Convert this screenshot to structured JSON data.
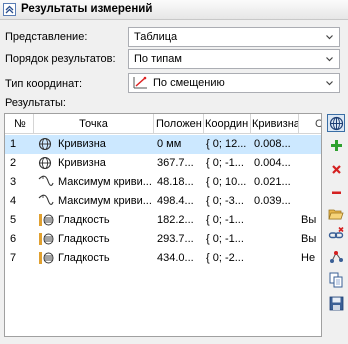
{
  "panel": {
    "title": "Результаты измерений"
  },
  "form": {
    "representation_label": "Представление:",
    "representation_value": "Таблица",
    "order_label": "Порядок результатов:",
    "order_value": "По типам",
    "coord_type_label": "Тип координат:",
    "coord_type_value": "По смещению",
    "results_label": "Результаты:"
  },
  "table": {
    "columns": [
      "№",
      "Точка",
      "Положен",
      "Координ",
      "Кривизна",
      "С"
    ],
    "rows": [
      {
        "num": "1",
        "icon": "curvature-icon",
        "point": "Кривизна",
        "pos": "0 мм",
        "coord": "{ 0; 12...",
        "curv": "0.008...",
        "extra": "",
        "selected": true
      },
      {
        "num": "2",
        "icon": "curvature-icon",
        "point": "Кривизна",
        "pos": "367.7...",
        "coord": "{ 0; -1...",
        "curv": "0.004...",
        "extra": "",
        "selected": false
      },
      {
        "num": "3",
        "icon": "curvature-max-icon",
        "point": "Максимум криви...",
        "pos": "48.18...",
        "coord": "{ 0; 10...",
        "curv": "0.021...",
        "extra": "",
        "selected": false
      },
      {
        "num": "4",
        "icon": "curvature-max-icon",
        "point": "Максимум криви...",
        "pos": "498.4...",
        "coord": "{ 0; -3...",
        "curv": "0.039...",
        "extra": "",
        "selected": false
      },
      {
        "num": "5",
        "icon": "smoothness-icon",
        "point": "Гладкость",
        "pos": "182.2...",
        "coord": "{ 0; -1...",
        "curv": "",
        "extra": "Вы",
        "selected": false
      },
      {
        "num": "6",
        "icon": "smoothness-icon",
        "point": "Гладкость",
        "pos": "293.7...",
        "coord": "{ 0; -1...",
        "curv": "",
        "extra": "Вы",
        "selected": false
      },
      {
        "num": "7",
        "icon": "smoothness-icon",
        "point": "Гладкость",
        "pos": "434.0...",
        "coord": "{ 0; -2...",
        "curv": "",
        "extra": "Не",
        "selected": false
      }
    ]
  },
  "toolbar": [
    "measure-icon",
    "add-icon",
    "delete-icon",
    "remove-icon",
    "open-folder-icon",
    "unlink-icon",
    "points-icon",
    "copy-icon",
    "save-icon"
  ],
  "colors": {
    "selection": "#cce8ff",
    "accent": "#3a6ea5"
  }
}
